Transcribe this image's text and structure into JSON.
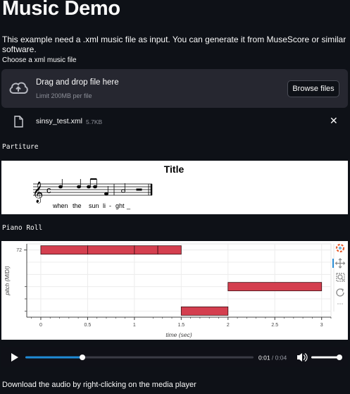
{
  "page": {
    "title": "Music Demo",
    "intro": "This example need a .xml music file as input. You can generate it from MuseScore or similar software."
  },
  "uploader": {
    "label": "Choose a xml music file",
    "drop_text": "Drag and drop file here",
    "limit_text": "Limit 200MB per file",
    "browse_label": "Browse files",
    "file_name": "sinsy_test.xml",
    "file_size": "5.7KB",
    "remove_glyph": "✕"
  },
  "partiture": {
    "heading": "Partiture",
    "title": "Title",
    "lyrics": [
      "when",
      "the",
      "sun",
      "li",
      "-",
      "ght",
      "_"
    ]
  },
  "piano_roll": {
    "heading": "Piano Roll",
    "toolbar_icons": [
      "bokeh-logo-icon",
      "pan-icon",
      "box-zoom-icon",
      "reset-icon"
    ]
  },
  "chart_data": {
    "type": "bar",
    "xlabel": "time (sec)",
    "ylabel": "pitch (MIDI)",
    "xlim": [
      -0.15,
      3.1
    ],
    "x_ticks": [
      "0",
      "0.5",
      "1",
      "1.5",
      "2",
      "2.5",
      "3"
    ],
    "y_ticks": [
      "72"
    ],
    "ylim": [
      66.5,
      72.5
    ],
    "notes": [
      {
        "start": 0.0,
        "end": 0.5,
        "pitch": 72
      },
      {
        "start": 0.5,
        "end": 1.0,
        "pitch": 72
      },
      {
        "start": 1.0,
        "end": 1.25,
        "pitch": 72
      },
      {
        "start": 1.25,
        "end": 1.5,
        "pitch": 72
      },
      {
        "start": 1.5,
        "end": 2.0,
        "pitch": 67
      },
      {
        "start": 2.0,
        "end": 3.0,
        "pitch": 69
      }
    ],
    "note_color": "#d43f4f"
  },
  "player": {
    "current_time": "0:01",
    "separator": " / ",
    "duration": "0:04",
    "progress": 0.25,
    "volume": 1.0,
    "accent": "#1f8bd6"
  },
  "footer": {
    "text": "Download the audio by right-clicking on the media player"
  }
}
